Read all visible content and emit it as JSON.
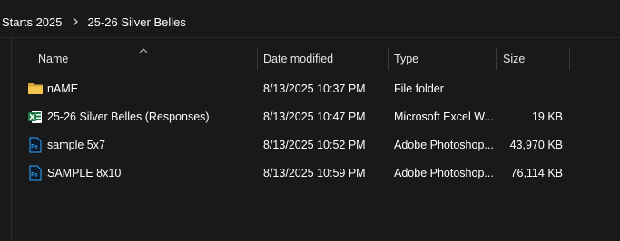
{
  "breadcrumb": {
    "items": [
      "Starts 2025",
      "25-26 Silver Belles"
    ]
  },
  "columns": {
    "name": "Name",
    "date": "Date modified",
    "type": "Type",
    "size": "Size"
  },
  "files": [
    {
      "name": "nAME",
      "date": "8/13/2025 10:37 PM",
      "type": "File folder",
      "size": "",
      "icon": "folder-icon"
    },
    {
      "name": "25-26 Silver Belles (Responses)",
      "date": "8/13/2025 10:47 PM",
      "type": "Microsoft Excel W...",
      "size": "19 KB",
      "icon": "excel-icon"
    },
    {
      "name": "sample 5x7",
      "date": "8/13/2025 10:52 PM",
      "type": "Adobe Photoshop...",
      "size": "43,970 KB",
      "icon": "photoshop-icon"
    },
    {
      "name": "SAMPLE 8x10",
      "date": "8/13/2025 10:59 PM",
      "type": "Adobe Photoshop...",
      "size": "76,114 KB",
      "icon": "photoshop-icon"
    }
  ],
  "colors": {
    "background": "#191919",
    "folder": "#e8b844",
    "excel": "#1d7a45",
    "photoshop": "#31a8ff"
  }
}
